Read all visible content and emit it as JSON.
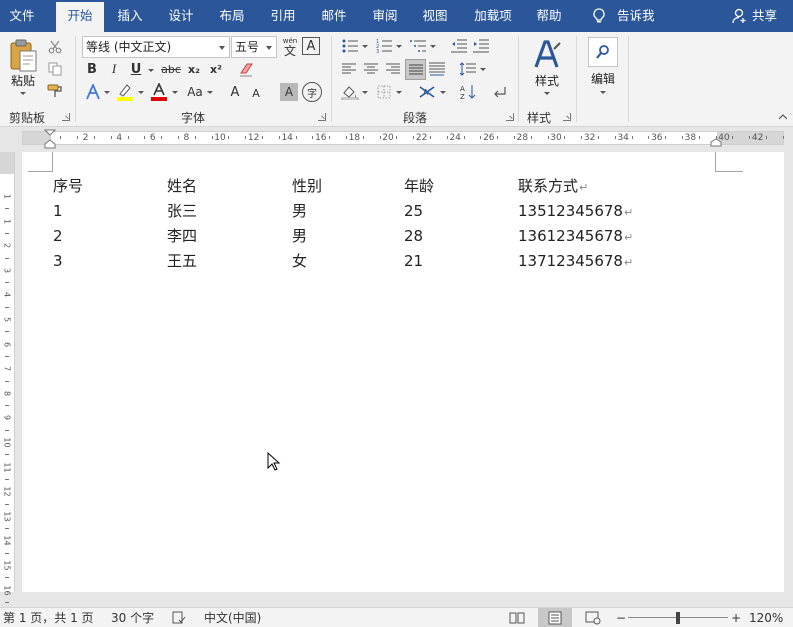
{
  "tabs": [
    {
      "label": "文件",
      "active": false
    },
    {
      "label": "开始",
      "active": true
    },
    {
      "label": "插入",
      "active": false
    },
    {
      "label": "设计",
      "active": false
    },
    {
      "label": "布局",
      "active": false
    },
    {
      "label": "引用",
      "active": false
    },
    {
      "label": "邮件",
      "active": false
    },
    {
      "label": "审阅",
      "active": false
    },
    {
      "label": "视图",
      "active": false
    },
    {
      "label": "加载项",
      "active": false
    },
    {
      "label": "帮助",
      "active": false
    }
  ],
  "tell_me": "告诉我",
  "share": "共享",
  "ribbon": {
    "clipboard": {
      "label": "剪贴板",
      "paste": "粘贴"
    },
    "font": {
      "label": "字体",
      "font_name": "等线 (中文正文)",
      "font_size": "五号",
      "phonetic": "wén",
      "phonetic_char": "文",
      "border_char": "A",
      "bold": "B",
      "italic": "I",
      "underline": "U",
      "strike": "abc",
      "sub": "x₂",
      "sup": "x²",
      "case": "Aa",
      "grow": "A",
      "shrink": "A",
      "shade_char": "A",
      "enclose_char": "字"
    },
    "paragraph": {
      "label": "段落"
    },
    "styles": {
      "label": "样式",
      "button": "样式"
    },
    "editing": {
      "button": "编辑"
    }
  },
  "ruler": {
    "numbers": [
      "2",
      "4",
      "6",
      "8",
      "10",
      "12",
      "14",
      "16",
      "18",
      "20",
      "22",
      "24",
      "26",
      "28",
      "30",
      "32",
      "34",
      "36",
      "38",
      "40",
      "42"
    ],
    "vnumbers": [
      "1",
      "1",
      "2",
      "3",
      "4",
      "5",
      "6",
      "7",
      "8",
      "9",
      "10",
      "11",
      "12",
      "13",
      "14",
      "15",
      "16"
    ]
  },
  "document": {
    "headers": [
      "序号",
      "姓名",
      "性别",
      "年龄",
      "联系方式"
    ],
    "rows": [
      [
        "1",
        "张三",
        "男",
        "25",
        "13512345678"
      ],
      [
        "2",
        "李四",
        "男",
        "28",
        "13612345678"
      ],
      [
        "3",
        "王五",
        "女",
        "21",
        "13712345678"
      ]
    ],
    "paragraph_mark": "↵"
  },
  "status": {
    "page": "第 1 页，共 1 页",
    "words": "30 个字",
    "language": "中文(中国)",
    "zoom": "120%",
    "zoom_minus": "−",
    "zoom_plus": "+"
  },
  "colors": {
    "accent": "#2b579a",
    "highlight": "#ffff00",
    "font_red": "#e00000",
    "text_effect": "#3f7ad6"
  }
}
